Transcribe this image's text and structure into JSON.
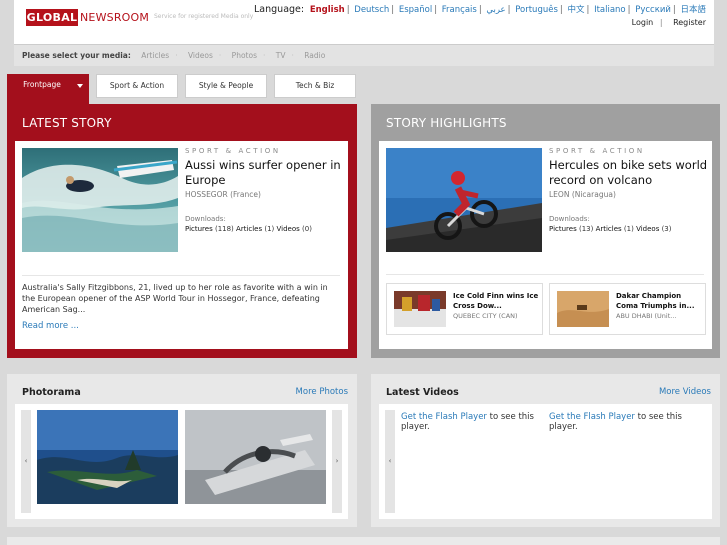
{
  "header": {
    "logo_global": "GLOBAL",
    "logo_newsroom": "NEWSROOM",
    "logo_tagline": "Service for registered Media only",
    "language_label": "Language:",
    "languages": [
      "English",
      "Deutsch",
      "Español",
      "Français",
      "عربي",
      "Português",
      "中文",
      "Italiano",
      "Русский",
      "日本語"
    ],
    "active_language": "English",
    "login": "Login",
    "register": "Register"
  },
  "mediabar": {
    "label": "Please select your media:",
    "options": [
      "Articles",
      "Videos",
      "Photos",
      "TV",
      "Radio"
    ]
  },
  "tabs": [
    "Frontpage",
    "Sport & Action",
    "Style & People",
    "Tech & Biz"
  ],
  "latest_story": {
    "panel_title": "LATEST STORY",
    "category": "SPORT & ACTION",
    "title": "Aussi wins surfer opener in Europe",
    "location": "HOSSEGOR (France)",
    "downloads_label": "Downloads:",
    "pictures_label": "Pictures",
    "pictures_count": "(118)",
    "articles_label": "Articles",
    "articles_count": "(1)",
    "videos_label": "Videos",
    "videos_count": "(0)",
    "body": "Australia's Sally Fitzgibbons, 21, lived up to her role as favorite with a win in the European opener of the ASP World Tour in Hossegor, France, defeating American Sag...",
    "read_more": "Read more ..."
  },
  "story_highlights": {
    "panel_title": "STORY HIGHLIGHTS",
    "category": "SPORT & ACTION",
    "title": "Hercules on bike sets world record on volcano",
    "location": "LEON (Nicaragua)",
    "downloads_label": "Downloads:",
    "pictures_label": "Pictures",
    "pictures_count": "(13)",
    "articles_label": "Articles",
    "articles_count": "(1)",
    "videos_label": "Videos",
    "videos_count": "(3)",
    "mini": [
      {
        "title": "Ice Cold Finn wins Ice Cross Dow...",
        "location": "QUEBEC CITY (CAN)"
      },
      {
        "title": "Dakar Champion Coma Triumphs in...",
        "location": "ABU DHABI (Unit..."
      }
    ]
  },
  "photorama": {
    "title": "Photorama",
    "more": "More Photos",
    "prev": "‹",
    "next": "›"
  },
  "latest_videos": {
    "title": "Latest Videos",
    "more": "More Videos",
    "prev": "‹",
    "flash_link": "Get the Flash Player",
    "flash_text": " to see this player."
  },
  "colors": {
    "brand_red": "#a30f1c",
    "link_blue": "#2a7ab8",
    "highlight_gray": "#a0a0a0"
  }
}
